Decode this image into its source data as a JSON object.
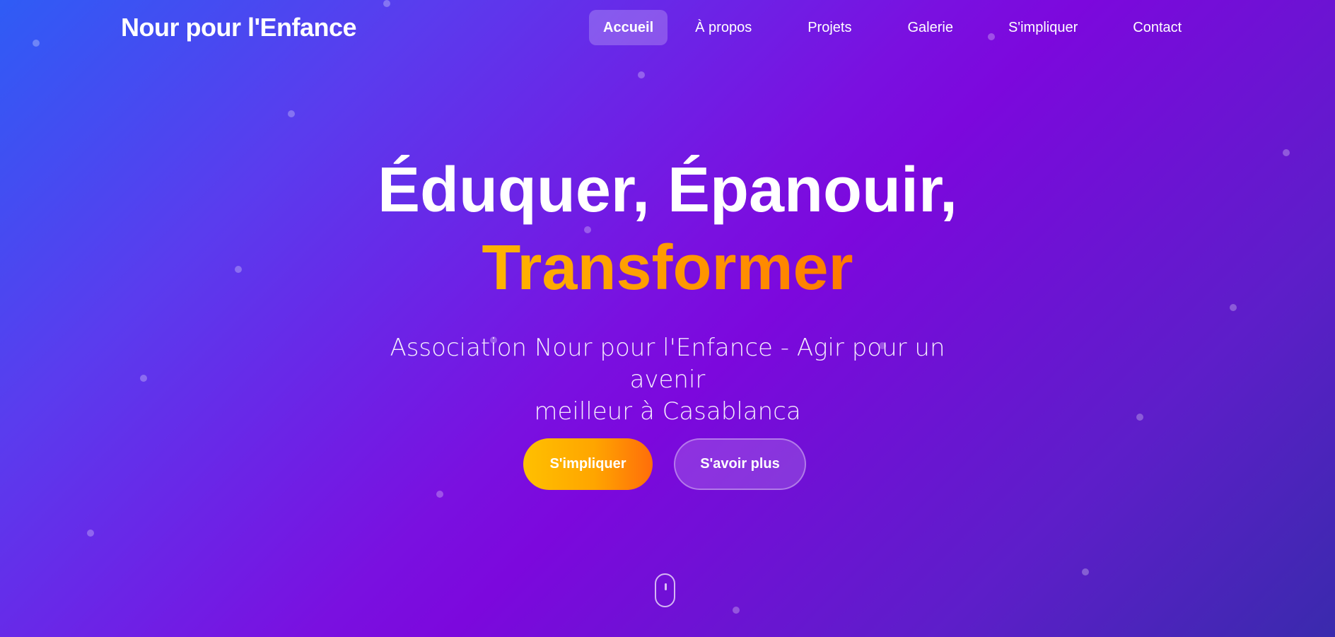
{
  "header": {
    "brand": "Nour pour l'Enfance",
    "nav": [
      {
        "label": "Accueil",
        "active": true
      },
      {
        "label": "À propos",
        "active": false
      },
      {
        "label": "Projets",
        "active": false
      },
      {
        "label": "Galerie",
        "active": false
      },
      {
        "label": "S'impliquer",
        "active": false
      },
      {
        "label": "Contact",
        "active": false
      }
    ]
  },
  "hero": {
    "headline_line1": "Éduquer, Épanouir,",
    "headline_line2": "Transformer",
    "subtitle_line1": "Association Nour pour l'Enfance - Agir pour un avenir",
    "subtitle_line2": "meilleur à Casablanca",
    "primary_button": "S'impliquer",
    "secondary_button": "S'avoir plus"
  },
  "icons": {
    "scroll_indicator": "mouse-scroll-icon"
  },
  "colors": {
    "gradient_start": "#2f5cf5",
    "gradient_mid": "#7a10e0",
    "gradient_end": "#3a2aad",
    "accent_start": "#ffc000",
    "accent_end": "#ff6d0a"
  }
}
